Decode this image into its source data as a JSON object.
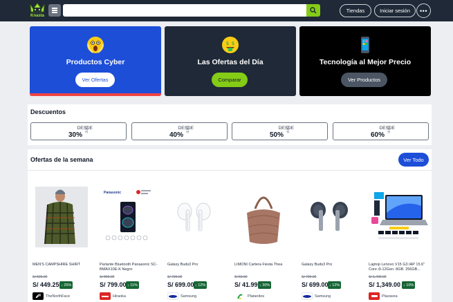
{
  "header": {
    "logo_text": "Knasta",
    "search": {
      "placeholder": "",
      "value": ""
    },
    "tiendas_label": "Tiendas",
    "login_label": "Iniciar sesión",
    "more_icon": "ellipsis-icon"
  },
  "banners": [
    {
      "title": "Productos Cyber",
      "button": "Ver Ofertas",
      "emoji": "scream",
      "bg": "#1d4ed8",
      "stripe": "#ef4444",
      "button_bg": "#ffffff",
      "button_fg": "#1d4ed8"
    },
    {
      "title": "Las Ofertas del Día",
      "button": "Comparar",
      "emoji": "money-mouth",
      "bg": "#1f2937",
      "button_bg": "#84cc16",
      "button_fg": "#111827"
    },
    {
      "title": "Tecnología al Mejor Precio",
      "button": "Ver Productos",
      "emoji": "mobile-phone",
      "bg": "#000000",
      "button_bg": "#4b5563",
      "button_fg": "#ffffff"
    }
  ],
  "descuentos": {
    "title": "Descuentos",
    "items": [
      {
        "desde": "DESDE",
        "pct": "30%",
        "off": "OFF"
      },
      {
        "desde": "DESDE",
        "pct": "40%",
        "off": "OFF"
      },
      {
        "desde": "DESDE",
        "pct": "50%",
        "off": "OFF"
      },
      {
        "desde": "DESDE",
        "pct": "60%",
        "off": "OFF"
      }
    ]
  },
  "ofertas": {
    "title": "Ofertas de la semana",
    "ver_todo": "Ver Todo",
    "products": [
      {
        "name": "MEN'S CAMPSHIRE SHIRT",
        "old_price": "S/ 599.00",
        "price": "S/ 449.25",
        "discount": "25%",
        "store": "TheNorthFace",
        "store_color": "#000000",
        "image": "plaid-shirt"
      },
      {
        "name": "Parlante Bluetooth Panasonic SC-BMAX10E-K Negro",
        "old_price": "S/ 899.00",
        "price": "S/ 799.00",
        "discount": "11%",
        "store": "Hiraoka",
        "store_color": "#dc2626",
        "image": "speaker"
      },
      {
        "name": "Galaxy Buds3 Pro",
        "old_price": "S/ 799.00",
        "price": "S/ 699.00",
        "discount": "12%",
        "store": "Samsung",
        "store_color": "#1428a0",
        "image": "white-earbuds"
      },
      {
        "name": "LIMONI Cartera Fiesta Thea",
        "old_price": "S/ 59.90",
        "price": "S/ 41.99",
        "discount": "30%",
        "store": "Platanitos",
        "store_color": "#16a34a",
        "image": "handbag"
      },
      {
        "name": "Galaxy Buds3 Pro",
        "old_price": "S/ 799.00",
        "price": "S/ 699.00",
        "discount": "12%",
        "store": "Samsung",
        "store_color": "#1428a0",
        "image": "gray-earbuds"
      },
      {
        "name": "Laptop Lenovo V15 G3 IAP 15.6\" Core i3-12Gen. 8GB. 256GB...",
        "old_price": "S/ 1,499.00",
        "price": "S/ 1,349.00",
        "discount": "10%",
        "store": "Plazavea",
        "store_color": "#dc2626",
        "image": "laptop"
      }
    ]
  }
}
